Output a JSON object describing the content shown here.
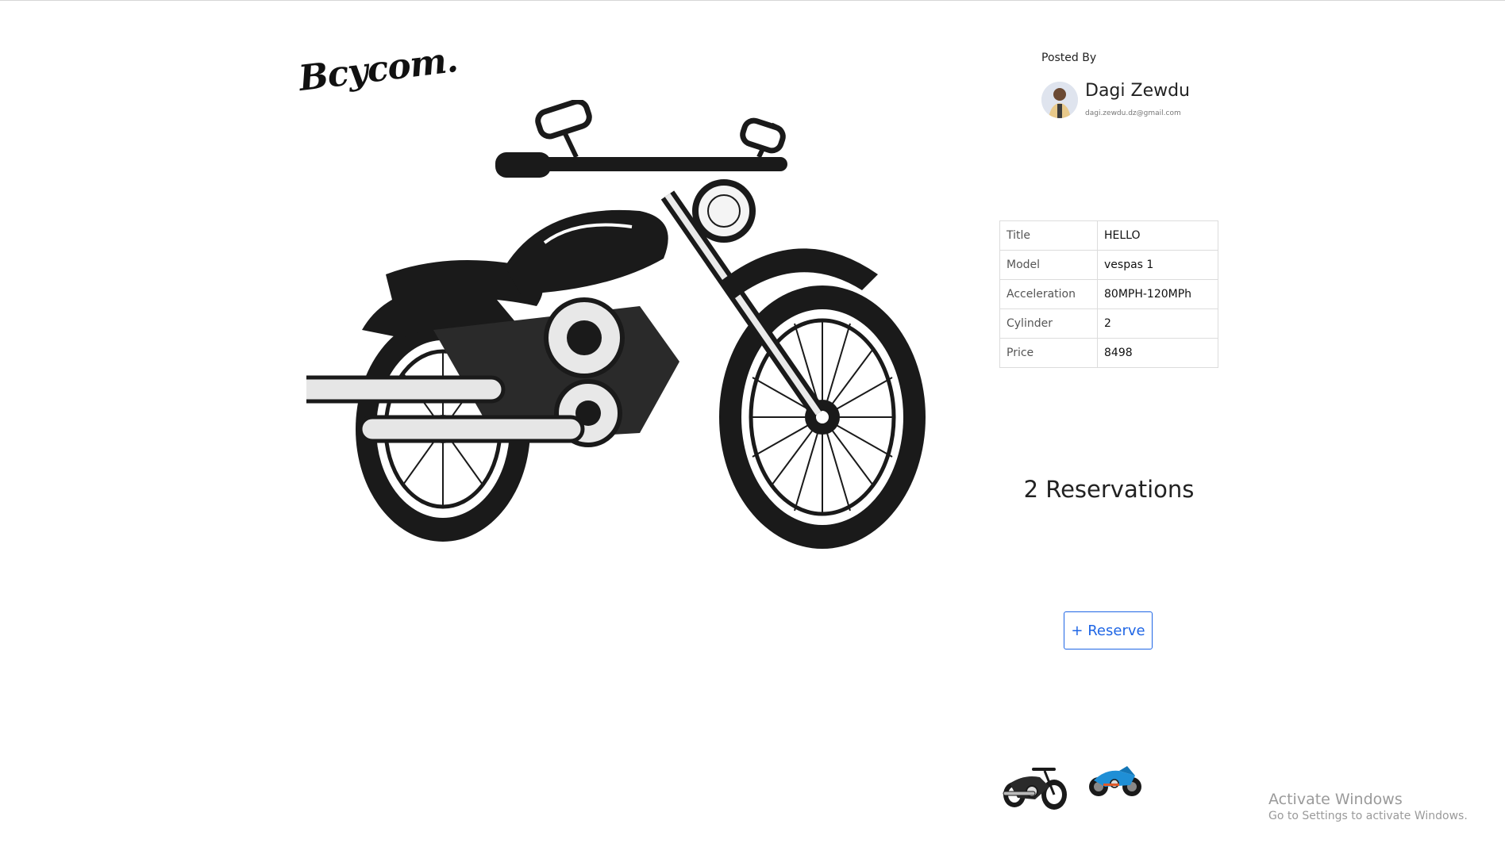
{
  "brand": {
    "logo_text": "Bcycom."
  },
  "poster": {
    "heading": "Posted By",
    "name": "Dagi Zewdu",
    "email": "dagi.zewdu.dz@gmail.com"
  },
  "specs": [
    {
      "label": "Title",
      "value": "HELLO"
    },
    {
      "label": "Model",
      "value": "vespas 1"
    },
    {
      "label": "Acceleration",
      "value": "80MPH-120MPh"
    },
    {
      "label": "Cylinder",
      "value": "2"
    },
    {
      "label": "Price",
      "value": "8498"
    }
  ],
  "reservations": {
    "text": "2 Reservations"
  },
  "actions": {
    "reserve_label": "+ Reserve"
  },
  "gallery": {
    "thumbnails": [
      "black-cruiser-motorcycle",
      "blue-sport-motorcycle"
    ]
  },
  "watermark": {
    "title": "Activate Windows",
    "subtitle": "Go to Settings to activate Windows."
  },
  "colors": {
    "accent": "#1f66e5",
    "border": "#dcdcdc"
  }
}
